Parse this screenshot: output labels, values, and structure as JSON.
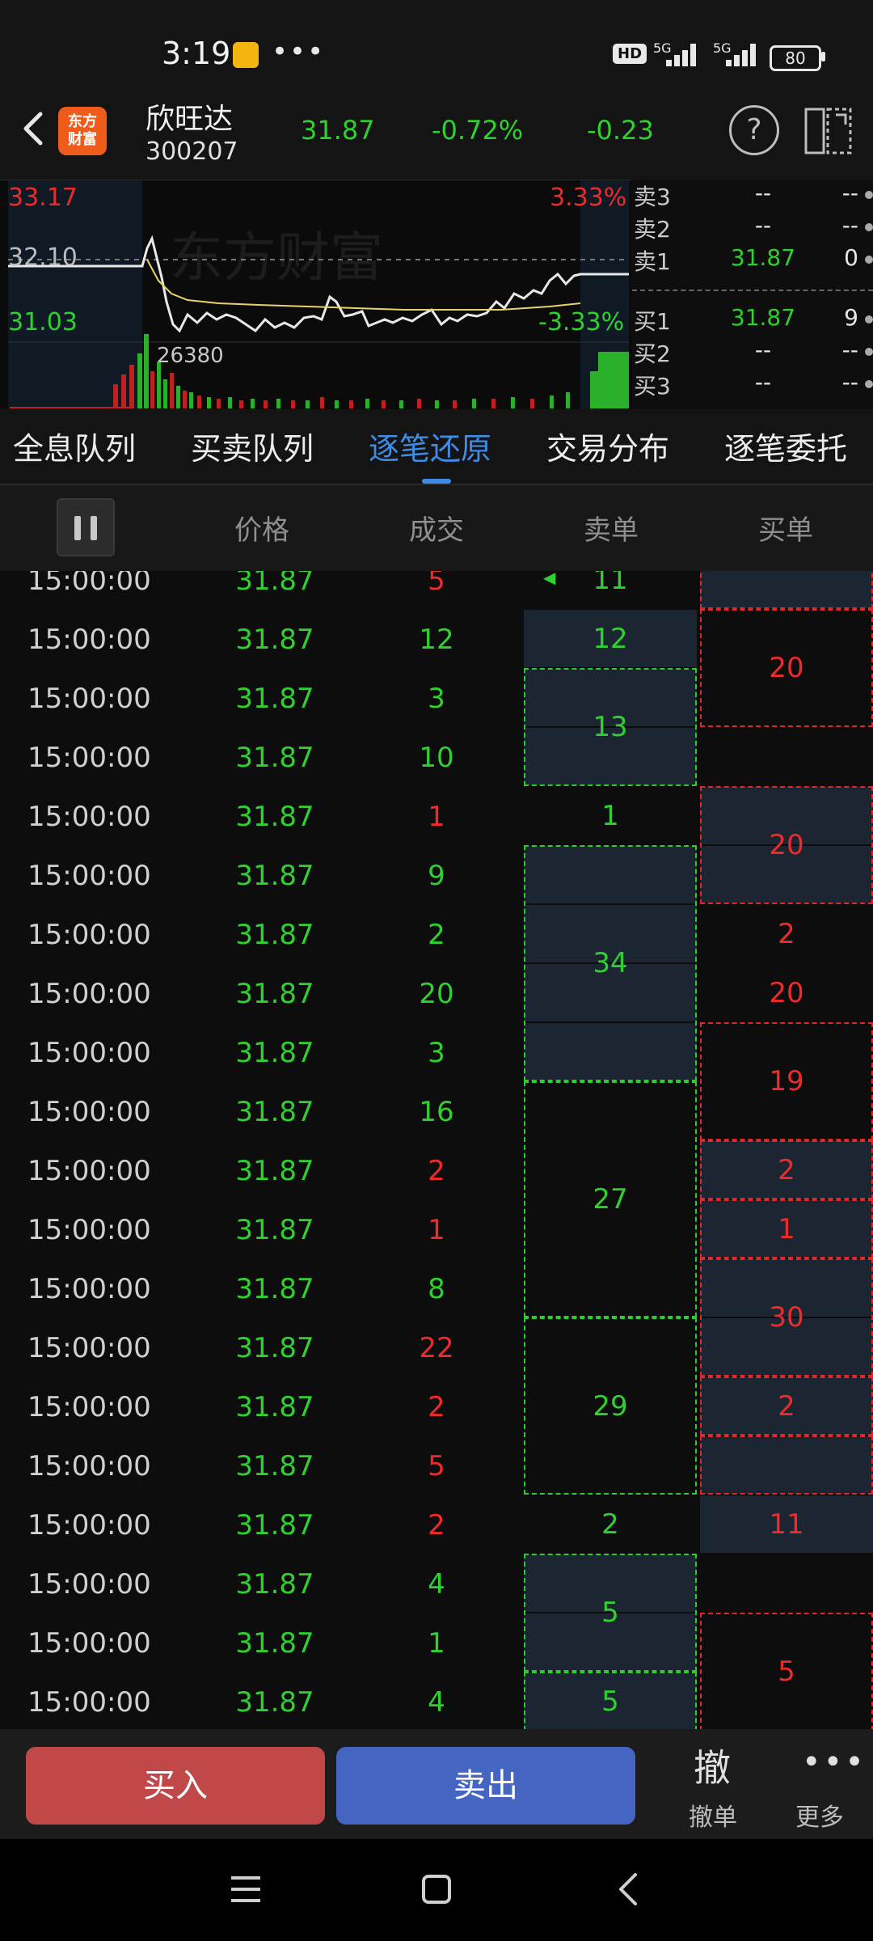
{
  "status": {
    "time": "3:19",
    "dots": "•••",
    "hd": "HD",
    "net1": "5G",
    "net2": "5G",
    "battery": "80"
  },
  "header": {
    "stock_name": "欣旺达",
    "stock_code": "300207",
    "logo_text_1": "东方",
    "logo_text_2": "财富",
    "price": "31.87",
    "change_pct": "-0.72%",
    "change": "-0.23",
    "help": "?"
  },
  "chart": {
    "high": "33.17",
    "high_pct": "3.33%",
    "ref": "32.10",
    "low": "31.03",
    "low_pct": "-3.33%",
    "volume_label": "26380",
    "watermark": "东方财富"
  },
  "orderbook": {
    "sell": [
      {
        "label": "卖3",
        "price": "--",
        "vol": "--"
      },
      {
        "label": "卖2",
        "price": "--",
        "vol": "--"
      },
      {
        "label": "卖1",
        "price": "31.87",
        "vol": "0"
      }
    ],
    "buy": [
      {
        "label": "买1",
        "price": "31.87",
        "vol": "9"
      },
      {
        "label": "买2",
        "price": "--",
        "vol": "--"
      },
      {
        "label": "买3",
        "price": "--",
        "vol": "--"
      }
    ]
  },
  "tabs": [
    "全息队列",
    "买卖队列",
    "逐笔还原",
    "交易分布",
    "逐笔委托"
  ],
  "active_tab": 2,
  "columns": {
    "price": "价格",
    "deal": "成交",
    "sell": "卖单",
    "buy": "买单"
  },
  "rows": [
    {
      "time": "15:00:00",
      "price": "31.87",
      "vol": "5",
      "dir": "up"
    },
    {
      "time": "15:00:00",
      "price": "31.87",
      "vol": "12",
      "dir": "dn"
    },
    {
      "time": "15:00:00",
      "price": "31.87",
      "vol": "3",
      "dir": "dn"
    },
    {
      "time": "15:00:00",
      "price": "31.87",
      "vol": "10",
      "dir": "dn"
    },
    {
      "time": "15:00:00",
      "price": "31.87",
      "vol": "1",
      "dir": "up"
    },
    {
      "time": "15:00:00",
      "price": "31.87",
      "vol": "9",
      "dir": "dn"
    },
    {
      "time": "15:00:00",
      "price": "31.87",
      "vol": "2",
      "dir": "dn"
    },
    {
      "time": "15:00:00",
      "price": "31.87",
      "vol": "20",
      "dir": "dn"
    },
    {
      "time": "15:00:00",
      "price": "31.87",
      "vol": "3",
      "dir": "dn"
    },
    {
      "time": "15:00:00",
      "price": "31.87",
      "vol": "16",
      "dir": "dn"
    },
    {
      "time": "15:00:00",
      "price": "31.87",
      "vol": "2",
      "dir": "up"
    },
    {
      "time": "15:00:00",
      "price": "31.87",
      "vol": "1",
      "dir": "up"
    },
    {
      "time": "15:00:00",
      "price": "31.87",
      "vol": "8",
      "dir": "dn"
    },
    {
      "time": "15:00:00",
      "price": "31.87",
      "vol": "22",
      "dir": "up"
    },
    {
      "time": "15:00:00",
      "price": "31.87",
      "vol": "2",
      "dir": "up"
    },
    {
      "time": "15:00:00",
      "price": "31.87",
      "vol": "5",
      "dir": "up"
    },
    {
      "time": "15:00:00",
      "price": "31.87",
      "vol": "2",
      "dir": "up"
    },
    {
      "time": "15:00:00",
      "price": "31.87",
      "vol": "4",
      "dir": "dn"
    },
    {
      "time": "15:00:00",
      "price": "31.87",
      "vol": "1",
      "dir": "dn"
    },
    {
      "time": "15:00:00",
      "price": "31.87",
      "vol": "4",
      "dir": "dn"
    }
  ],
  "sell_blocks": [
    {
      "start": 0,
      "span": 1,
      "label": "11",
      "shade": false,
      "border": false
    },
    {
      "start": 1,
      "span": 1,
      "label": "12",
      "shade": true,
      "border": false
    },
    {
      "start": 2,
      "span": 2,
      "label": "13",
      "shade": true,
      "border": true
    },
    {
      "start": 4,
      "span": 1,
      "label": "1",
      "shade": false,
      "border": false
    },
    {
      "start": 5,
      "span": 4,
      "label": "34",
      "shade": true,
      "border": true
    },
    {
      "start": 9,
      "span": 4,
      "label": "27",
      "shade": false,
      "border": true
    },
    {
      "start": 13,
      "span": 3,
      "label": "29",
      "shade": false,
      "border": true
    },
    {
      "start": 16,
      "span": 1,
      "label": "2",
      "shade": false,
      "border": false
    },
    {
      "start": 17,
      "span": 2,
      "label": "5",
      "shade": true,
      "border": true
    },
    {
      "start": 19,
      "span": 1,
      "label": "5",
      "shade": true,
      "border": true
    }
  ],
  "buy_blocks": [
    {
      "start": 0,
      "span": 1,
      "label": "",
      "shade": true,
      "border": true
    },
    {
      "start": 1,
      "span": 2,
      "label": "20",
      "shade": false,
      "border": true
    },
    {
      "start": 3,
      "span": 1,
      "label": "",
      "shade": false,
      "border": false
    },
    {
      "start": 4,
      "span": 2,
      "label": "20",
      "shade": true,
      "border": true
    },
    {
      "start": 6,
      "span": 1,
      "label": "2",
      "shade": false,
      "border": false
    },
    {
      "start": 7,
      "span": 1,
      "label": "20",
      "shade": false,
      "border": false
    },
    {
      "start": 8,
      "span": 2,
      "label": "19",
      "shade": false,
      "border": true
    },
    {
      "start": 10,
      "span": 1,
      "label": "2",
      "shade": true,
      "border": true
    },
    {
      "start": 11,
      "span": 1,
      "label": "1",
      "shade": true,
      "border": true
    },
    {
      "start": 12,
      "span": 2,
      "label": "30",
      "shade": true,
      "border": true
    },
    {
      "start": 14,
      "span": 1,
      "label": "2",
      "shade": true,
      "border": true
    },
    {
      "start": 15,
      "span": 1,
      "label": "",
      "shade": true,
      "border": true
    },
    {
      "start": 16,
      "span": 1,
      "label": "11",
      "shade": true,
      "border": false
    },
    {
      "start": 17,
      "span": 1,
      "label": "",
      "shade": false,
      "border": false
    },
    {
      "start": 18,
      "span": 2,
      "label": "5",
      "shade": false,
      "border": true
    }
  ],
  "bottom": {
    "buy": "买入",
    "sell": "卖出",
    "cancel_big": "撤",
    "cancel": "撤单",
    "more_dots": "•••",
    "more": "更多"
  },
  "colors": {
    "up": "#ee2a2a",
    "down": "#2fd02f",
    "accent": "#3d8ce6"
  }
}
